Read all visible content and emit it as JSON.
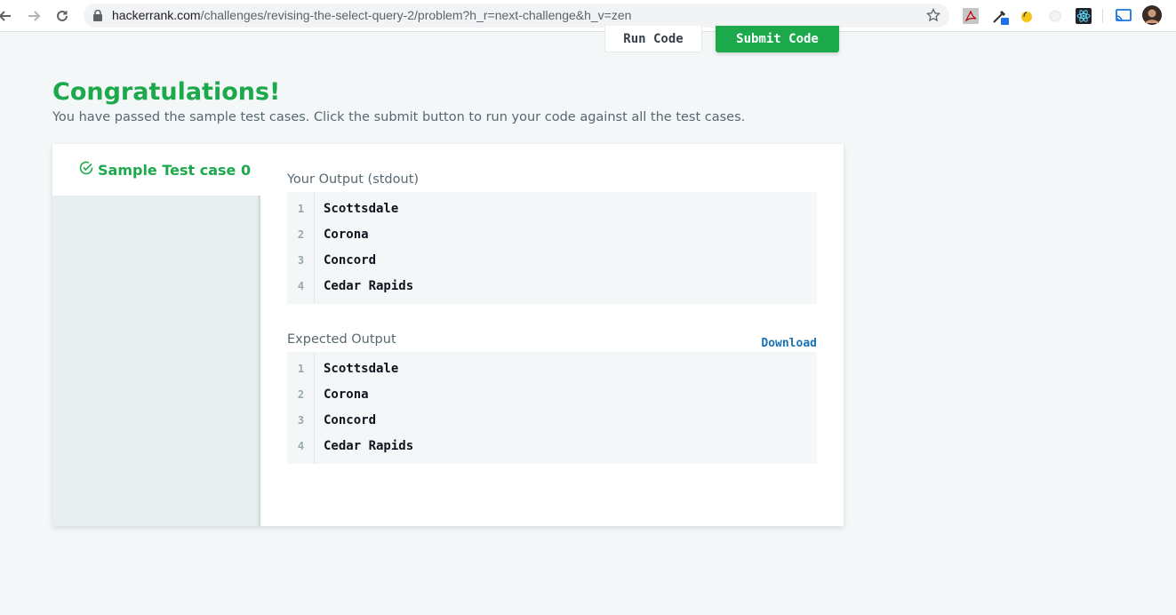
{
  "browser": {
    "url_host": "hackerrank.com",
    "url_path": "/challenges/revising-the-select-query-2/problem?h_r=next-challenge&h_v=zen",
    "icons": [
      "back-arrow-icon",
      "forward-arrow-icon",
      "reload-icon",
      "lock-icon",
      "star-icon",
      "pdf-extension-icon",
      "eyedropper-extension-icon",
      "hand-extension-icon",
      "circle-extension-icon",
      "react-extension-icon",
      "cast-icon",
      "avatar"
    ]
  },
  "toolbar": {
    "run_label": "Run Code",
    "submit_label": "Submit Code"
  },
  "result": {
    "title": "Congratulations!",
    "subtitle": "You have passed the sample test cases. Click the submit button to run your code against all the test cases."
  },
  "testcase": {
    "tab_label": "Sample Test case 0",
    "your_output_label": "Your Output (stdout)",
    "expected_output_label": "Expected Output",
    "download_label": "Download",
    "your_output": [
      {
        "n": "1",
        "text": "Scottsdale"
      },
      {
        "n": "2",
        "text": "Corona"
      },
      {
        "n": "3",
        "text": "Concord"
      },
      {
        "n": "4",
        "text": "Cedar Rapids"
      }
    ],
    "expected_output": [
      {
        "n": "1",
        "text": "Scottsdale"
      },
      {
        "n": "2",
        "text": "Corona"
      },
      {
        "n": "3",
        "text": "Concord"
      },
      {
        "n": "4",
        "text": "Cedar Rapids"
      }
    ]
  },
  "colors": {
    "success": "#1ba94c",
    "link": "#1a73b5",
    "background": "#f3f7f7"
  }
}
